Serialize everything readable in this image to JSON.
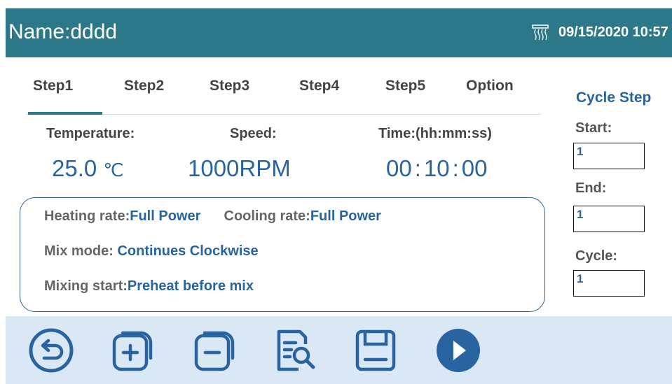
{
  "header": {
    "title": "Name:dddd",
    "heater_icon": "heater-icon",
    "datetime": "09/15/2020 10:57"
  },
  "tabs": [
    "Step1",
    "Step2",
    "Step3",
    "Step4",
    "Step5",
    "Option"
  ],
  "active_tab": "Step1",
  "params": {
    "temperature_label": "Temperature:",
    "speed_label": "Speed:",
    "time_label": "Time:(hh:mm:ss)",
    "temperature_value": "25.0",
    "temperature_unit": "℃",
    "speed_value": "1000",
    "speed_unit": "RPM",
    "time_hh": "00",
    "time_mm": "10",
    "time_ss": "00"
  },
  "options": {
    "heating_label": "Heating rate:",
    "heating_value": "Full Power",
    "cooling_label": "Cooling rate:",
    "cooling_value": "Full Power",
    "mix_mode_label": "Mix mode:",
    "mix_mode_value": "Continues Clockwise",
    "mixing_start_label": "Mixing start:",
    "mixing_start_value": "Preheat before mix"
  },
  "cycle": {
    "title": "Cycle Step",
    "start_label": "Start:",
    "start_value": "1",
    "end_label": "End:",
    "end_value": "1",
    "cycle_label": "Cycle:",
    "cycle_value": "1"
  },
  "toolbar": {
    "icons": [
      "back-icon",
      "add-step-icon",
      "remove-step-icon",
      "preview-icon",
      "save-icon",
      "play-icon"
    ]
  },
  "colors": {
    "header_bg": "#2d7888",
    "accent_blue": "#2a64a0",
    "toolbar_bg": "#dae8f6"
  }
}
